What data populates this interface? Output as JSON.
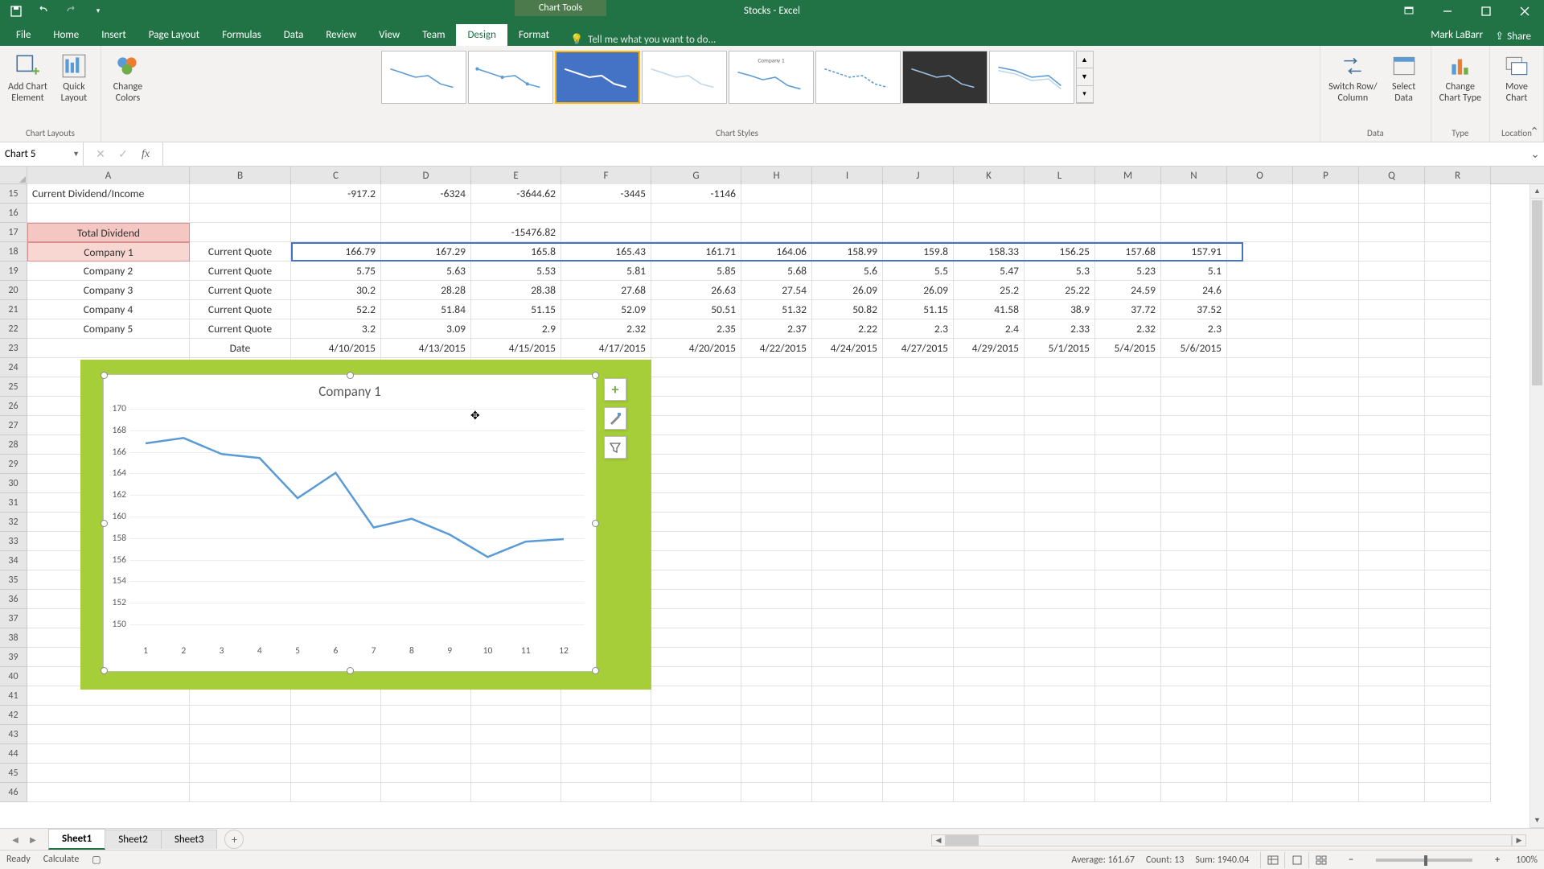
{
  "app_title": "Stocks - Excel",
  "chart_tools_label": "Chart Tools",
  "user_name": "Mark LaBarr",
  "share_label": "Share",
  "tell_me_placeholder": "Tell me what you want to do...",
  "tabs": [
    "File",
    "Home",
    "Insert",
    "Page Layout",
    "Formulas",
    "Data",
    "Review",
    "View",
    "Team"
  ],
  "context_tabs": [
    "Design",
    "Format"
  ],
  "active_tab": "Design",
  "ribbon": {
    "layouts": {
      "add_element": "Add Chart\nElement",
      "quick_layout": "Quick\nLayout",
      "group": "Chart Layouts"
    },
    "colors": {
      "change_colors": "Change\nColors"
    },
    "styles_group": "Chart Styles",
    "data": {
      "switch": "Switch Row/\nColumn",
      "select": "Select\nData",
      "group": "Data"
    },
    "type": {
      "change": "Change\nChart Type",
      "group": "Type"
    },
    "location": {
      "move": "Move\nChart",
      "group": "Location"
    }
  },
  "name_box": "Chart 5",
  "columns": [
    "A",
    "B",
    "C",
    "D",
    "E",
    "F",
    "G",
    "H",
    "I",
    "J",
    "K",
    "L",
    "M",
    "N",
    "O",
    "P",
    "Q",
    "R"
  ],
  "rows_visible": [
    15,
    16,
    17,
    18,
    19,
    20,
    21,
    22,
    23,
    24,
    25,
    26,
    27,
    28,
    29,
    30,
    31,
    32,
    33,
    34,
    35,
    36,
    37,
    38,
    39,
    40,
    41,
    42,
    43,
    44,
    45,
    46
  ],
  "cells": {
    "r15": {
      "A": "Current Dividend/Income",
      "C": "-917.2",
      "D": "-6324",
      "E": "-3644.62",
      "F": "-3445",
      "G": "-1146"
    },
    "r17": {
      "A": "Total Dividend",
      "E": "-15476.82"
    },
    "r18": {
      "A": "Company 1",
      "B": "Current Quote",
      "C": "166.79",
      "D": "167.29",
      "E": "165.8",
      "F": "165.43",
      "G": "161.71",
      "H": "164.06",
      "I": "158.99",
      "J": "159.8",
      "K": "158.33",
      "L": "156.25",
      "M": "157.68",
      "N": "157.91"
    },
    "r19": {
      "A": "Company 2",
      "B": "Current Quote",
      "C": "5.75",
      "D": "5.63",
      "E": "5.53",
      "F": "5.81",
      "G": "5.85",
      "H": "5.68",
      "I": "5.6",
      "J": "5.5",
      "K": "5.47",
      "L": "5.3",
      "M": "5.23",
      "N": "5.1"
    },
    "r20": {
      "A": "Company 3",
      "B": "Current Quote",
      "C": "30.2",
      "D": "28.28",
      "E": "28.38",
      "F": "27.68",
      "G": "26.63",
      "H": "27.54",
      "I": "26.09",
      "J": "26.09",
      "K": "25.2",
      "L": "25.22",
      "M": "24.59",
      "N": "24.6"
    },
    "r21": {
      "A": "Company 4",
      "B": "Current Quote",
      "C": "52.2",
      "D": "51.84",
      "E": "51.15",
      "F": "52.09",
      "G": "50.51",
      "H": "51.32",
      "I": "50.82",
      "J": "51.15",
      "K": "41.58",
      "L": "38.9",
      "M": "37.72",
      "N": "37.52"
    },
    "r22": {
      "A": "Company 5",
      "B": "Current Quote",
      "C": "3.2",
      "D": "3.09",
      "E": "2.9",
      "F": "2.32",
      "G": "2.35",
      "H": "2.37",
      "I": "2.22",
      "J": "2.3",
      "K": "2.4",
      "L": "2.33",
      "M": "2.32",
      "N": "2.3"
    },
    "r23": {
      "B": "Date",
      "C": "4/10/2015",
      "D": "4/13/2015",
      "E": "4/15/2015",
      "F": "4/17/2015",
      "G": "4/20/2015",
      "H": "4/22/2015",
      "I": "4/24/2015",
      "J": "4/27/2015",
      "K": "4/29/2015",
      "L": "5/1/2015",
      "M": "5/4/2015",
      "N": "5/6/2015"
    }
  },
  "chart_data": {
    "type": "line",
    "title": "Company 1",
    "categories": [
      1,
      2,
      3,
      4,
      5,
      6,
      7,
      8,
      9,
      10,
      11,
      12
    ],
    "values": [
      166.79,
      167.29,
      165.8,
      165.43,
      161.71,
      164.06,
      158.99,
      159.8,
      158.33,
      156.25,
      157.68,
      157.91
    ],
    "ylim": [
      150,
      170
    ],
    "yticks": [
      150,
      152,
      154,
      156,
      158,
      160,
      162,
      164,
      166,
      168,
      170
    ],
    "xlabel": "",
    "ylabel": ""
  },
  "sheet_tabs": [
    "Sheet1",
    "Sheet2",
    "Sheet3"
  ],
  "active_sheet": "Sheet1",
  "status": {
    "ready": "Ready",
    "calculate": "Calculate",
    "average": "Average: 161.67",
    "count": "Count: 13",
    "sum": "Sum: 1940.04",
    "zoom": "100%"
  }
}
